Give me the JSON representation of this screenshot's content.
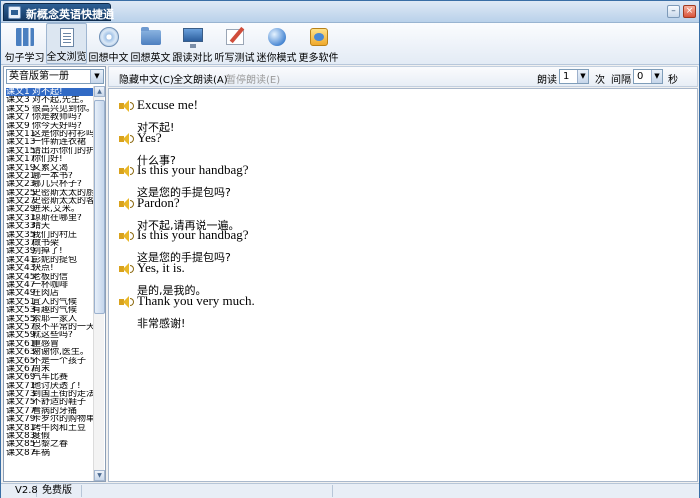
{
  "window": {
    "title": "新概念英语快捷通",
    "minimize": "–",
    "close": "×"
  },
  "toolbar": [
    {
      "label": "句子学习",
      "icon": "sentence-grid-icon"
    },
    {
      "label": "全文浏览",
      "icon": "document-page-icon",
      "active": true
    },
    {
      "label": "回想中文",
      "icon": "cd-disc-icon"
    },
    {
      "label": "回想英文",
      "icon": "folder-icon"
    },
    {
      "label": "跟读对比",
      "icon": "monitor-icon"
    },
    {
      "label": "听写测试",
      "icon": "dictation-pen-icon"
    },
    {
      "label": "迷你模式",
      "icon": "mini-orb-icon"
    },
    {
      "label": "更多软件",
      "icon": "software-box-icon"
    }
  ],
  "sidebar": {
    "book": "英音版第一册",
    "lessons": [
      {
        "num": "课文1",
        "title": "对不起!",
        "selected": true
      },
      {
        "num": "课文3",
        "title": "对不起,先生。"
      },
      {
        "num": "课文5",
        "title": "很高兴见到你。"
      },
      {
        "num": "课文7",
        "title": "你是教师吗?"
      },
      {
        "num": "课文9",
        "title": "你今天好吗?"
      },
      {
        "num": "课文11",
        "title": "这是你的衬衫吗?"
      },
      {
        "num": "课文13",
        "title": "一件新连衣裙"
      },
      {
        "num": "课文15",
        "title": "请出示你们的护照。"
      },
      {
        "num": "课文17",
        "title": "你们好!"
      },
      {
        "num": "课文19",
        "title": "又累又渴"
      },
      {
        "num": "课文21",
        "title": "哪一本书?"
      },
      {
        "num": "课文23",
        "title": "哪几只杯子?"
      },
      {
        "num": "课文25",
        "title": "史密斯太太的厨房"
      },
      {
        "num": "课文27",
        "title": "史密斯太太的客厅"
      },
      {
        "num": "课文29",
        "title": "进来,艾米。"
      },
      {
        "num": "课文31",
        "title": "琼斯在哪里?"
      },
      {
        "num": "课文33",
        "title": "晴天"
      },
      {
        "num": "课文35",
        "title": "我们的村庄"
      },
      {
        "num": "课文37",
        "title": "做书架"
      },
      {
        "num": "课文39",
        "title": "别掉了!"
      },
      {
        "num": "课文41",
        "title": "彭妮的提包"
      },
      {
        "num": "课文43",
        "title": "快点!"
      },
      {
        "num": "课文45",
        "title": "老板的信"
      },
      {
        "num": "课文47",
        "title": "一杯咖啡"
      },
      {
        "num": "课文49",
        "title": "在肉店"
      },
      {
        "num": "课文51",
        "title": "宜人的气候"
      },
      {
        "num": "课文53",
        "title": "有趣的气候"
      },
      {
        "num": "课文55",
        "title": "索耶一家人"
      },
      {
        "num": "课文57",
        "title": "很不平常的一天"
      },
      {
        "num": "课文59",
        "title": "就这些吗?"
      },
      {
        "num": "课文61",
        "title": "重感冒"
      },
      {
        "num": "课文63",
        "title": "谢谢你,医生。"
      },
      {
        "num": "课文65",
        "title": "不是一个孩子"
      },
      {
        "num": "课文67",
        "title": "周末"
      },
      {
        "num": "课文69",
        "title": "汽车比赛"
      },
      {
        "num": "课文71",
        "title": "他讨厌透了!"
      },
      {
        "num": "课文73",
        "title": "到国王街的走法"
      },
      {
        "num": "课文75",
        "title": "不舒适的鞋子"
      },
      {
        "num": "课文77",
        "title": "看病的牙痛"
      },
      {
        "num": "课文79",
        "title": "卡罗尔的购物单"
      },
      {
        "num": "课文81",
        "title": "烤牛肉和土豆"
      },
      {
        "num": "课文83",
        "title": "度假"
      },
      {
        "num": "课文85",
        "title": "巴黎之春"
      },
      {
        "num": "课文87",
        "title": "车祸"
      }
    ]
  },
  "controls": {
    "hide_chinese": "隐藏中文(C)",
    "read_all": "全文朗读(A)",
    "pause": "暂停朗读(E)",
    "repeat_label": "朗读",
    "repeat_value": "1",
    "repeat_unit": "次",
    "interval_label": "间隔",
    "interval_value": "0",
    "interval_unit": "秒"
  },
  "sentences": [
    {
      "en": "Excuse me!",
      "zh": "对不起!"
    },
    {
      "en": "Yes?",
      "zh": "什么事?"
    },
    {
      "en": "Is this your handbag?",
      "zh": "这是您的手提包吗?"
    },
    {
      "en": "Pardon?",
      "zh": "对不起,请再说一遍。"
    },
    {
      "en": "Is this your handbag?",
      "zh": "这是您的手提包吗?"
    },
    {
      "en": "Yes, it is.",
      "zh": "是的,是我的。"
    },
    {
      "en": "Thank you very much.",
      "zh": "非常感谢!"
    }
  ],
  "status": {
    "version": "V2.8",
    "edition": "免费版"
  },
  "colors": {
    "selection": "#316ac5",
    "title_tab": "#163a64"
  }
}
